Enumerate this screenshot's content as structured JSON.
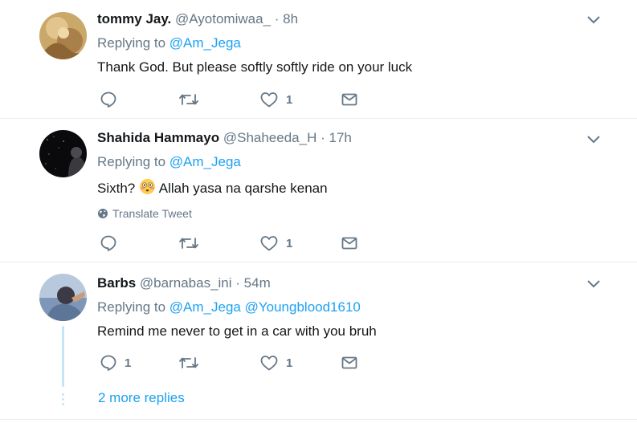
{
  "tweets": [
    {
      "name": "tommy Jay.",
      "handle": "@Ayotomiwaa_",
      "time": "8h",
      "replying_label": "Replying to",
      "replying_to": [
        "@Am_Jega"
      ],
      "text": "Thank God. But please softly softly ride on your luck",
      "reply_count": "",
      "retweet_count": "",
      "like_count": "1"
    },
    {
      "name": "Shahida Hammayo",
      "handle": "@Shaheeda_H",
      "time": "17h",
      "replying_label": "Replying to",
      "replying_to": [
        "@Am_Jega"
      ],
      "text_before_emoji": "Sixth?",
      "emoji": "flushed-face",
      "text_after_emoji": "Allah yasa na qarshe kenan",
      "translate_label": "Translate Tweet",
      "reply_count": "",
      "retweet_count": "",
      "like_count": "1"
    },
    {
      "name": "Barbs",
      "handle": "@barnabas_ini",
      "time": "54m",
      "replying_label": "Replying to",
      "replying_to": [
        "@Am_Jega",
        "@Youngblood1610"
      ],
      "text": "Remind me never to get in a car with you bruh",
      "reply_count": "1",
      "retweet_count": "",
      "like_count": "1"
    }
  ],
  "more_replies": "2 more replies",
  "colors": {
    "link": "#1da1f2",
    "secondary": "#657786",
    "thread_line": "#c4e4f9",
    "divider": "#e6ecf0"
  },
  "icons": [
    "reply-icon",
    "retweet-icon",
    "like-icon",
    "dm-icon",
    "chevron-down-icon",
    "globe-icon"
  ]
}
